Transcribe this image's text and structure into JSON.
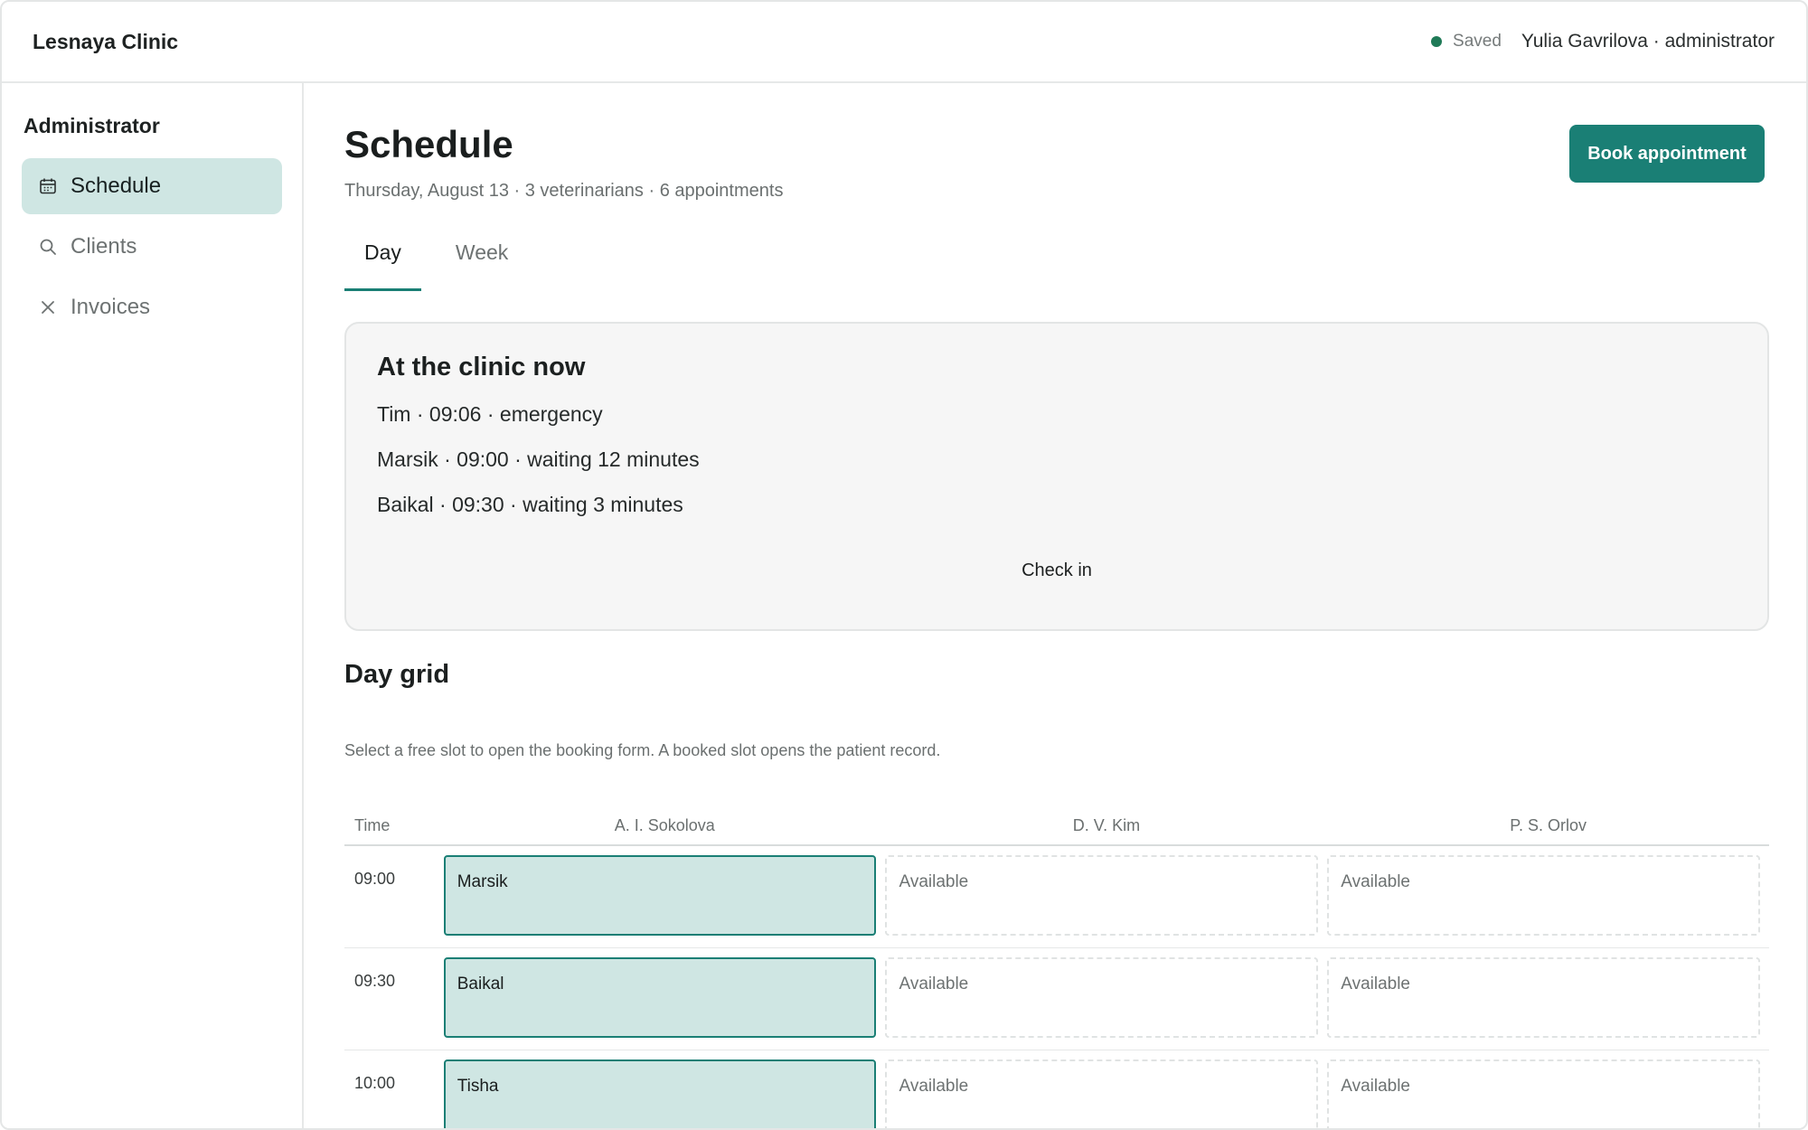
{
  "header": {
    "brand": "Lesnaya Clinic",
    "status": "Saved",
    "user": "Yulia Gavrilova · administrator"
  },
  "sidebar": {
    "title": "Administrator",
    "items": [
      {
        "label": "Schedule",
        "icon": "calendar-icon",
        "active": true
      },
      {
        "label": "Clients",
        "icon": "search-icon",
        "active": false
      },
      {
        "label": "Invoices",
        "icon": "close-icon",
        "active": false
      }
    ]
  },
  "main": {
    "title": "Schedule",
    "subtitle": "Thursday, August 13 · 3 veterinarians · 6 appointments",
    "book_button": "Book appointment",
    "tabs": [
      {
        "label": "Day",
        "active": true
      },
      {
        "label": "Week",
        "active": false
      }
    ],
    "now_card": {
      "title": "At the clinic now",
      "items": [
        "Tim · 09:06 · emergency",
        "Marsik · 09:00 · waiting 12 minutes",
        "Baikal · 09:30 · waiting 3 minutes"
      ],
      "check_in": "Check in"
    },
    "day_grid": {
      "title": "Day grid",
      "help": "Select a free slot to open the booking form. A booked slot opens the patient record.",
      "columns": [
        "Time",
        "A. I. Sokolova",
        "D. V. Kim",
        "P. S. Orlov"
      ],
      "rows": [
        {
          "time": "09:00",
          "slots": [
            {
              "label": "Marsik",
              "booked": true
            },
            {
              "label": "Available",
              "booked": false
            },
            {
              "label": "Available",
              "booked": false
            }
          ]
        },
        {
          "time": "09:30",
          "slots": [
            {
              "label": "Baikal",
              "booked": true
            },
            {
              "label": "Available",
              "booked": false
            },
            {
              "label": "Available",
              "booked": false
            }
          ]
        },
        {
          "time": "10:00",
          "slots": [
            {
              "label": "Tisha",
              "booked": true
            },
            {
              "label": "Available",
              "booked": false
            },
            {
              "label": "Available",
              "booked": false
            }
          ]
        }
      ]
    }
  },
  "colors": {
    "accent": "#1a7f75",
    "accent_light": "#cfe6e3",
    "saved_dot": "#1f7a57"
  }
}
